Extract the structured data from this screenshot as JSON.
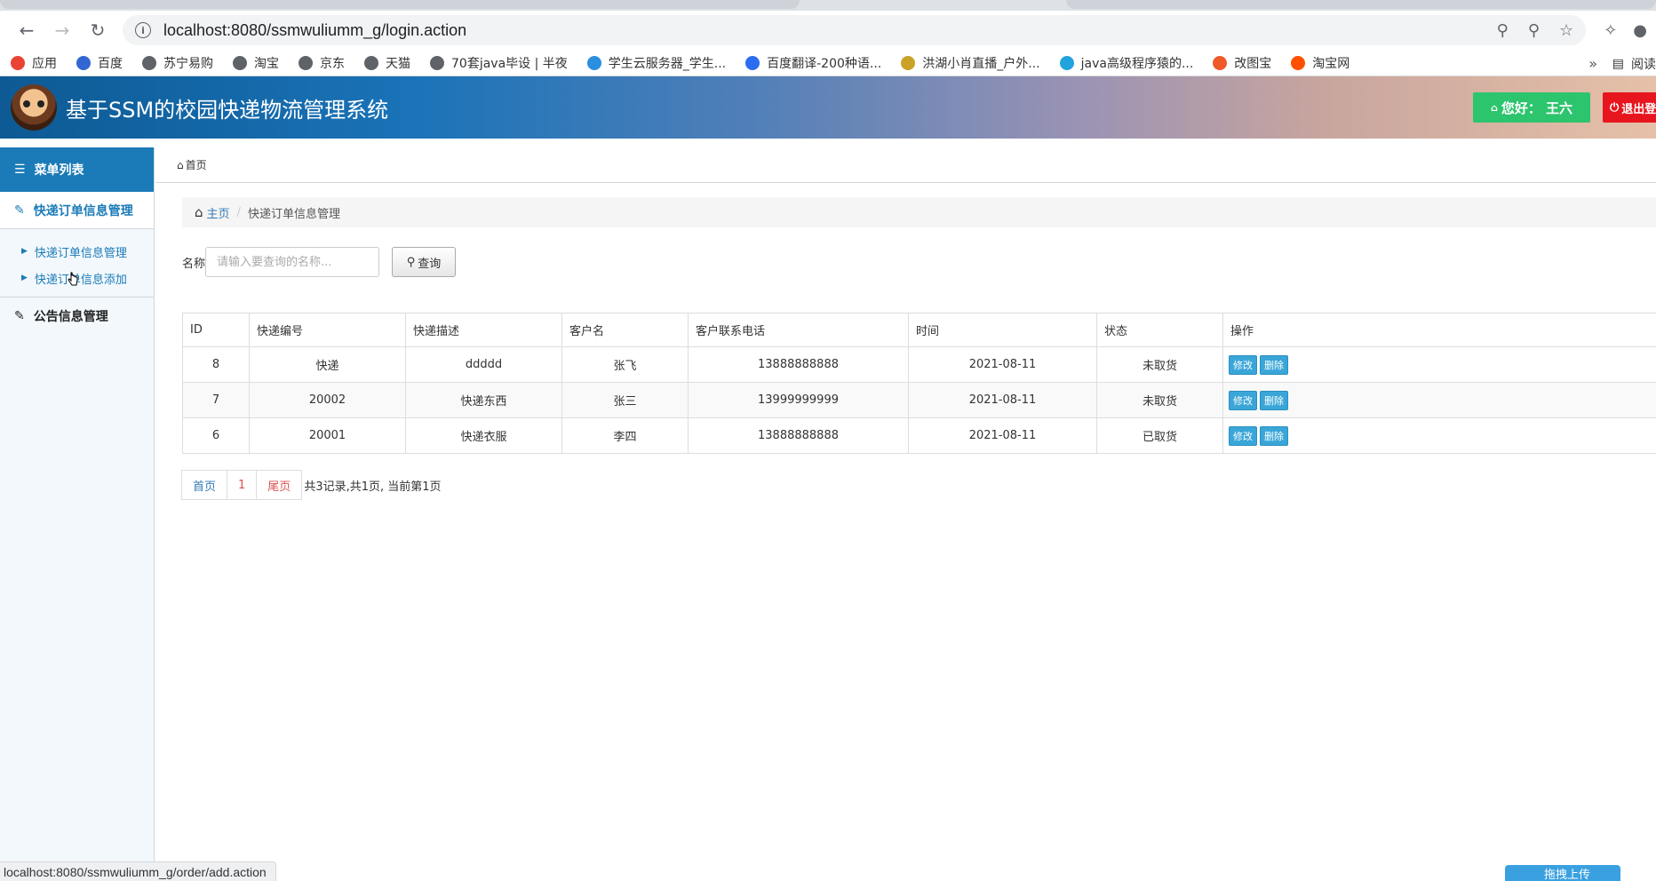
{
  "browser": {
    "url": "localhost:8080/ssmwuliumm_g/login.action",
    "bookmarks": [
      {
        "label": "应用",
        "color": "#e94335"
      },
      {
        "label": "百度",
        "color": "#3266d3"
      },
      {
        "label": "苏宁易购",
        "color": "#5f6368"
      },
      {
        "label": "淘宝",
        "color": "#5f6368"
      },
      {
        "label": "京东",
        "color": "#5f6368"
      },
      {
        "label": "天猫",
        "color": "#5f6368"
      },
      {
        "label": "70套java毕设 | 半夜",
        "color": "#5f6368"
      },
      {
        "label": "学生云服务器_学生...",
        "color": "#2b8fe0"
      },
      {
        "label": "百度翻译-200种语...",
        "color": "#2b6cf0"
      },
      {
        "label": "洪湖小肖直播_户外...",
        "color": "#c9a227"
      },
      {
        "label": "java高级程序猿的...",
        "color": "#23a3dd"
      },
      {
        "label": "改图宝",
        "color": "#f05a28"
      },
      {
        "label": "淘宝网",
        "color": "#ff5000"
      }
    ],
    "more": "»",
    "reading": "阅读"
  },
  "header": {
    "title": "基于SSM的校园快递物流管理系统",
    "greeting": "您好：  王六",
    "logout": "退出登录"
  },
  "sidebar": {
    "menu_title": "菜单列表",
    "group1": "快递订单信息管理",
    "sub_items": [
      "快递订单信息管理",
      "快递订单信息添加"
    ],
    "group2": "公告信息管理"
  },
  "main": {
    "top_crumb": "首页",
    "breadcrumb_home": "主页",
    "breadcrumb_current": "快递订单信息管理",
    "search_label": "名称",
    "search_placeholder": "请输入要查询的名称...",
    "search_button": "查询",
    "table": {
      "headers": [
        "ID",
        "快递编号",
        "快递描述",
        "客户名",
        "客户联系电话",
        "时间",
        "状态",
        "操作"
      ],
      "rows": [
        {
          "id": "8",
          "code": "快递",
          "desc": "ddddd",
          "customer": "张飞",
          "phone": "13888888888",
          "time": "2021-08-11",
          "status": "未取货"
        },
        {
          "id": "7",
          "code": "20002",
          "desc": "快递东西",
          "customer": "张三",
          "phone": "13999999999",
          "time": "2021-08-11",
          "status": "未取货"
        },
        {
          "id": "6",
          "code": "20001",
          "desc": "快递衣服",
          "customer": "李四",
          "phone": "13888888888",
          "time": "2021-08-11",
          "status": "已取货"
        }
      ],
      "edit_label": "修改",
      "delete_label": "删除"
    },
    "pager": {
      "first": "首页",
      "page": "1",
      "last": "尾页",
      "info": "共3记录,共1页, 当前第1页"
    }
  },
  "statusbar": {
    "text": "localhost:8080/ssmwuliumm_g/order/add.action"
  },
  "upload": {
    "label": "拖拽上传"
  }
}
